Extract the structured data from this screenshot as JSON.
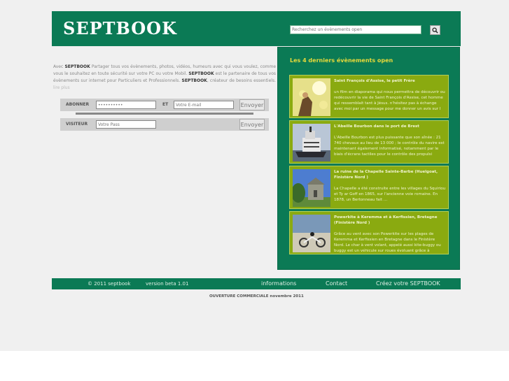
{
  "header": {
    "logo": "SEPTBOOK",
    "search_placeholder": "Recherchez un évènements open"
  },
  "intro": {
    "p1": "Avec ",
    "brand1": "SEPTBOOK",
    "p2": " Partager tous vos évènements, photos, vidéos, humeurs avec qui vous voulez, comme vous le souhaitez en toute sécurité sur votre PC ou votre Mobil. ",
    "brand2": "SEPTBOOK",
    "p3": " est le partenaire de tous vos évènements sur internet pour Particuliers et Professionnels. ",
    "brand3": "SEPTBOOK",
    "p4": ", créateur de besoins essentiels. ",
    "more": "lire plus"
  },
  "subscribe": {
    "label": "ABONNER",
    "password_value": "••••••••••",
    "and_label": "ET",
    "email_placeholder": "Votre E-mail",
    "button": "Envoyer"
  },
  "visitor": {
    "label": "VISITEUR",
    "pass_placeholder": "Votre Pass",
    "button": "Envoyer"
  },
  "events": {
    "title": "Les 4 derniers évènements open",
    "items": [
      {
        "title": "Saint François d'Assise, le petit Frère",
        "desc": "un film en diaporama qui nous permettra de découvrir ou redécouvrir la vie de Saint François d'Assise, cet homme qui ressemblait tant à Jésus. n'hésitez pas à échange avec moi par un message pour me donner un avis sur l"
      },
      {
        "title": "L'Abeille Bourbon dans le port de Brest",
        "desc": "L'Abeille Bourbon est plus puissante que son aînée : 21 740 chevaux au lieu de 13 000 ; le contrôle du navire est maintenant également informatisé, notamment par le biais d'écrans tactiles pour le contrôle des propulsi"
      },
      {
        "title": "La ruine de la Chapelle Sainte-Barbe (Huelgoat, Finistère Nord )",
        "desc": "La Chapelle a été construite entre les villages du Squiriou et Ty ar Goff en 1865, sur l'ancienne voie romaine. En 1878, un Bertonneau fait ..."
      },
      {
        "title": "Powerkite à Keremma et à Kerfissien, Bretagne (Finistère Nord )",
        "desc": "Grâce au vent avec son Powerkite sur les plages de Keremma et Kerfissien en Bretagne dans le Finistère Nord. Le char à vent volant, appelé aussi kite-buggy ou buggy est un véhicule sur roues évoluant grâce à"
      }
    ]
  },
  "footer": {
    "copyright": "© 2011 septbook",
    "version": "version beta 1.01",
    "informations": "informations",
    "contact": "Contact",
    "create": "Créez votre SEPTBOOK"
  },
  "opening": "OUVERTURE COMMERCIALE novembre 2011",
  "colors": {
    "brand_green": "#0b7a55",
    "event_green": "#8aaa10",
    "title_yellow": "#e6d93a"
  }
}
